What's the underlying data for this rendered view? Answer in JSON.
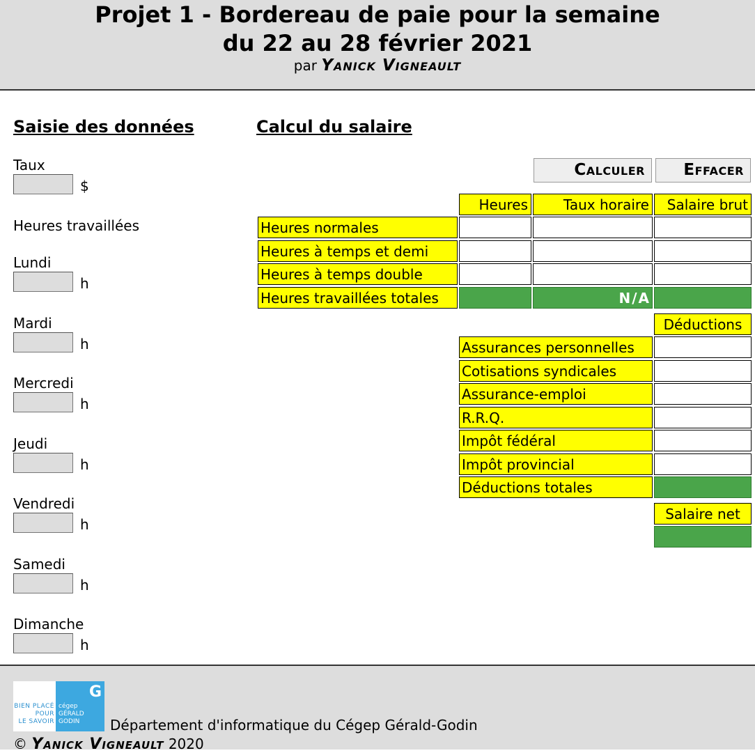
{
  "header": {
    "title_line1": "Projet 1 - Bordereau de paie pour la semaine",
    "title_line2": "du 22 au 28 février 2021",
    "by_prefix": "par",
    "author": "Yanick Vigneault"
  },
  "left": {
    "section_title": "Saisie des données",
    "rate_label": "Taux",
    "rate_unit": "$",
    "hours_heading": "Heures travaillées",
    "hours_unit": "h",
    "days": [
      "Lundi",
      "Mardi",
      "Mercredi",
      "Jeudi",
      "Vendredi",
      "Samedi",
      "Dimanche"
    ]
  },
  "right": {
    "section_title": "Calcul du salaire",
    "calc_button": "Calculer",
    "clear_button": "Effacer",
    "columns": [
      "Heures",
      "Taux horaire",
      "Salaire brut"
    ],
    "rows": [
      "Heures normales",
      "Heures à temps et demi",
      "Heures à temps double",
      "Heures travaillées totales"
    ],
    "na_text": "N/A",
    "deductions_header": "Déductions",
    "deductions": [
      "Assurances personnelles",
      "Cotisations syndicales",
      "Assurance-emploi",
      "R.R.Q.",
      "Impôt fédéral",
      "Impôt provincial",
      "Déductions totales"
    ],
    "net_header": "Salaire net"
  },
  "footer": {
    "logo_left_text": [
      "BIEN PLACÉ",
      "POUR",
      "LE SAVOIR"
    ],
    "logo_right_text": [
      "cégep",
      "GÉRALD",
      "GODIN"
    ],
    "logo_letter": "G",
    "department": "Département d'informatique du Cégep Gérald-Godin",
    "copyright_symbol": "©",
    "copyright_author": "Yanick Vigneault",
    "copyright_year": "2020"
  },
  "colors": {
    "header_bg": "#dddddd",
    "label_bg": "#ffff00",
    "result_green": "#4aa54a",
    "logo_blue": "#3da8e0"
  }
}
